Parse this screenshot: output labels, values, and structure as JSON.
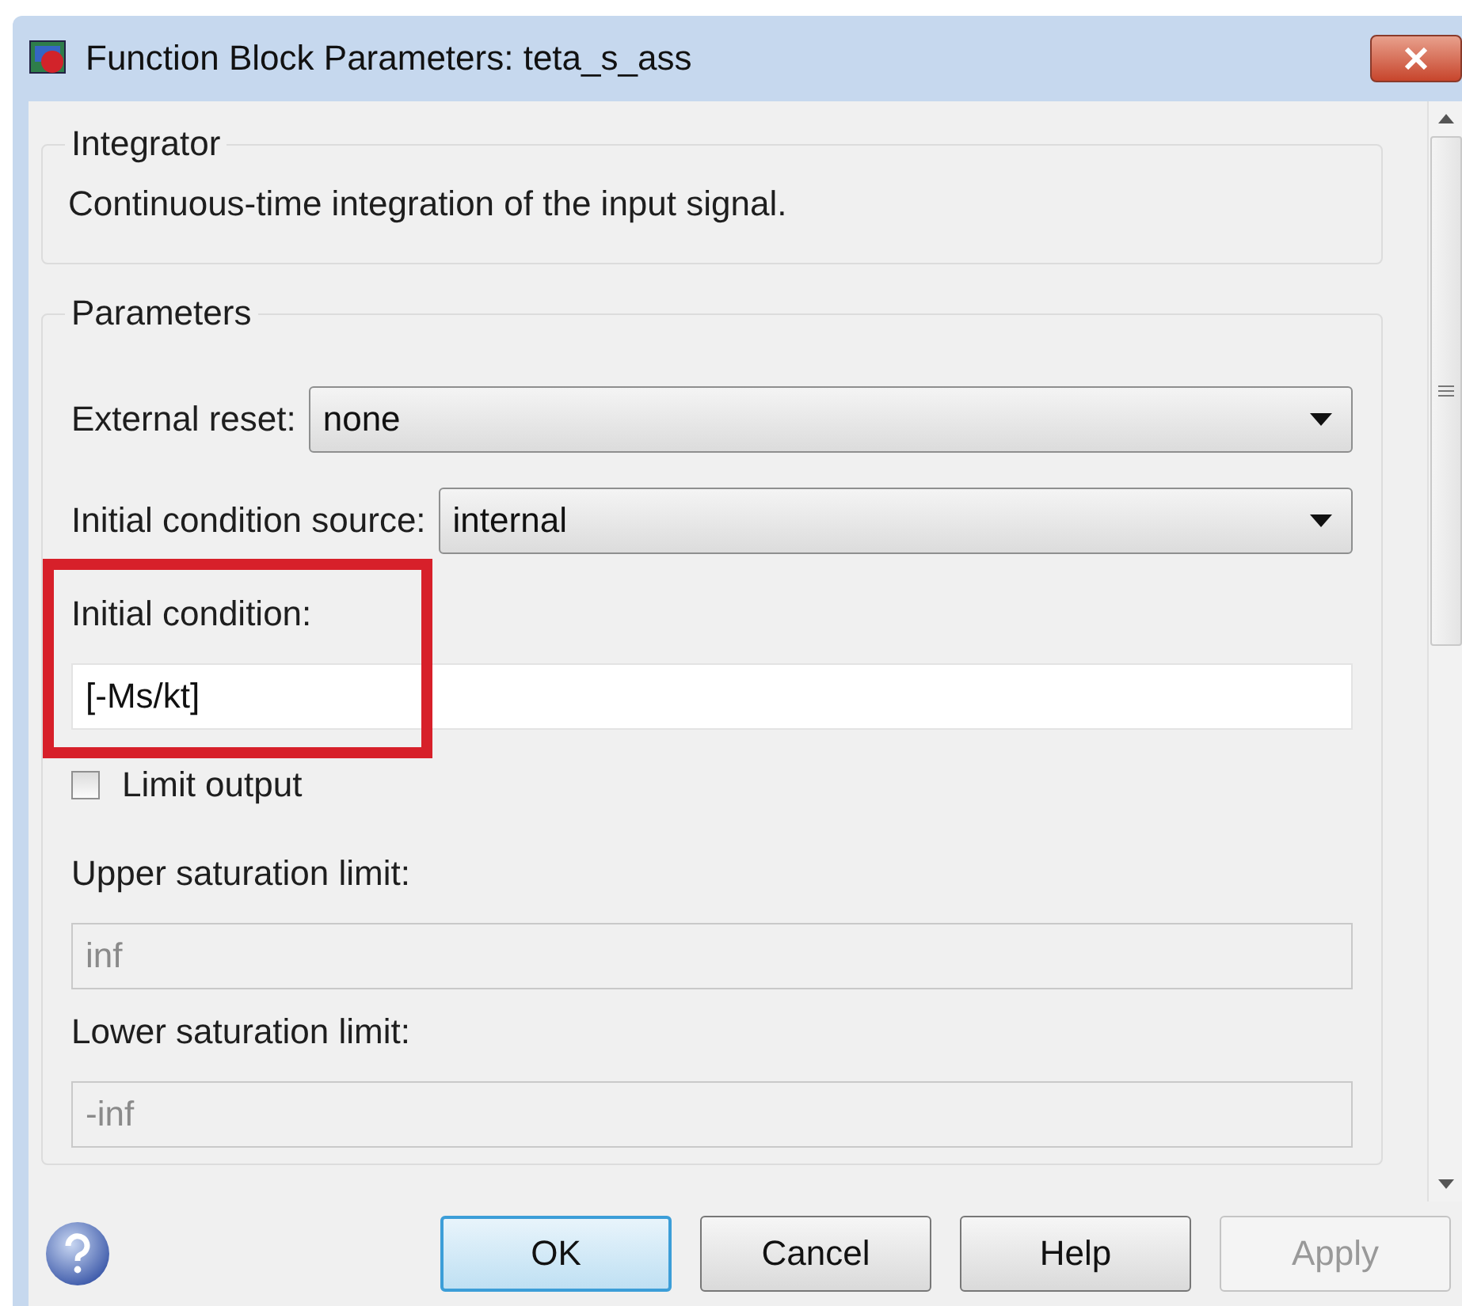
{
  "window": {
    "title": "Function Block Parameters: teta_s_ass"
  },
  "description_group": {
    "title": "Integrator",
    "text": "Continuous-time integration of the input signal."
  },
  "parameters_group": {
    "title": "Parameters",
    "fields": [
      {
        "kind": "dropdown",
        "label": "External reset:",
        "value": "none"
      },
      {
        "kind": "dropdown",
        "label": "Initial condition source:",
        "value": "internal"
      },
      {
        "kind": "text",
        "label": "Initial condition:",
        "value": "[-Ms/kt]",
        "disabled": false,
        "highlighted": true
      },
      {
        "kind": "checkbox",
        "label": "Limit output",
        "checked": false
      },
      {
        "kind": "text",
        "label": "Upper saturation limit:",
        "value": "inf",
        "disabled": true,
        "highlighted": false
      },
      {
        "kind": "text",
        "label": "Lower saturation limit:",
        "value": "-inf",
        "disabled": true,
        "highlighted": false
      }
    ]
  },
  "buttons": [
    {
      "label": "OK",
      "default": true,
      "disabled": false
    },
    {
      "label": "Cancel",
      "default": false,
      "disabled": false
    },
    {
      "label": "Help",
      "default": false,
      "disabled": false
    },
    {
      "label": "Apply",
      "default": false,
      "disabled": true
    }
  ]
}
